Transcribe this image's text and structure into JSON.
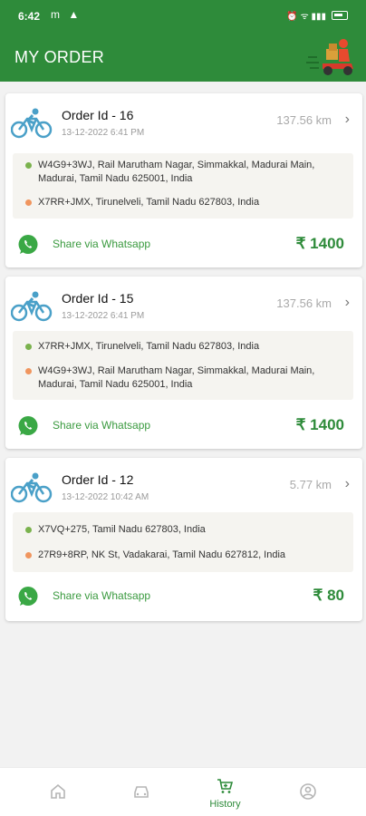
{
  "status_bar": {
    "time": "6:42",
    "left_icons": "m ▲",
    "signal_text": "⏰ ᯤ ▮▮▮"
  },
  "header": {
    "title": "MY ORDER"
  },
  "currency_symbol": "₹",
  "orders": [
    {
      "order_id": "Order Id - 16",
      "datetime": "13-12-2022 6:41 PM",
      "distance": "137.56 km",
      "pickup": "W4G9+3WJ, Rail Marutham Nagar, Simmakkal, Madurai Main, Madurai, Tamil Nadu 625001, India",
      "drop": "X7RR+JMX, Tirunelveli, Tamil Nadu 627803, India",
      "share_label": "Share via Whatsapp",
      "price": "₹ 1400"
    },
    {
      "order_id": "Order Id - 15",
      "datetime": "13-12-2022 6:41 PM",
      "distance": "137.56 km",
      "pickup": "X7RR+JMX, Tirunelveli, Tamil Nadu 627803, India",
      "drop": "W4G9+3WJ, Rail Marutham Nagar, Simmakkal, Madurai Main, Madurai, Tamil Nadu 625001, India",
      "share_label": "Share via Whatsapp",
      "price": "₹ 1400"
    },
    {
      "order_id": "Order Id - 12",
      "datetime": "13-12-2022 10:42 AM",
      "distance": "5.77 km",
      "pickup": "X7VQ+275, Tamil Nadu 627803, India",
      "drop": "27R9+8RP, NK St, Vadakarai, Tamil Nadu 627812, India",
      "share_label": "Share via Whatsapp",
      "price": "₹ 80"
    }
  ],
  "bottom_nav": [
    {
      "icon": "home-icon",
      "label": ""
    },
    {
      "icon": "car-icon",
      "label": ""
    },
    {
      "icon": "cart-icon",
      "label": "History",
      "active": true
    },
    {
      "icon": "profile-icon",
      "label": ""
    }
  ],
  "colors": {
    "brand_green": "#2e8b3a",
    "pickup_dot": "#7ab24d",
    "drop_dot": "#f0955e",
    "bike_icon": "#4aa0c8",
    "whatsapp": "#3aa845"
  }
}
